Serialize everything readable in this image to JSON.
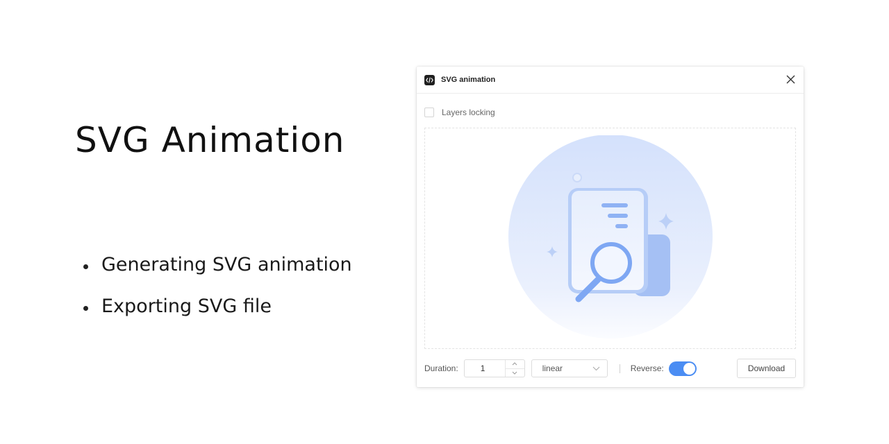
{
  "slide": {
    "title": "SVG Animation",
    "bullets": [
      "Generating SVG animation",
      "Exporting SVG file"
    ]
  },
  "dialog": {
    "title": "SVG animation",
    "icon": "code-icon",
    "layers_locking": {
      "label": "Layers locking",
      "checked": false
    },
    "preview": {
      "illustration": "document-search-icon"
    },
    "controls": {
      "duration_label": "Duration:",
      "duration_value": "1",
      "easing_value": "linear",
      "reverse_label": "Reverse:",
      "reverse_on": true,
      "download_label": "Download"
    }
  },
  "colors": {
    "accent": "#4b8df3",
    "illustration_circle": "#dbe6fd",
    "illustration_blue": "#7ea7f3"
  }
}
